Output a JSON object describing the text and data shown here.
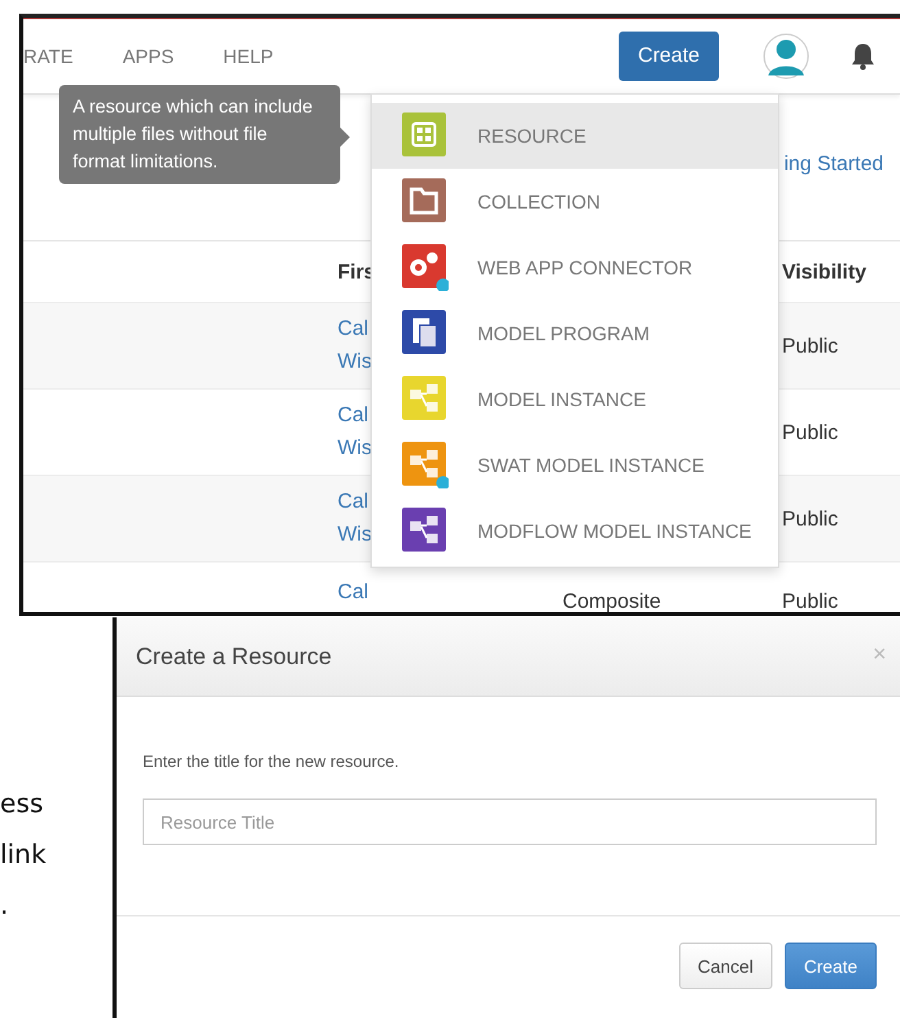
{
  "side_text": [
    "ess",
    "link",
    "."
  ],
  "nav": {
    "items": [
      "RATE",
      "APPS",
      "HELP"
    ],
    "create_button": "Create"
  },
  "getting_started_link": "ing Started",
  "table": {
    "columns": [
      "",
      "Firs",
      "",
      "Visibility"
    ],
    "rows": [
      {
        "column_2": [
          "Cal",
          "Wis"
        ],
        "column_3": "",
        "visibility": "Public"
      },
      {
        "column_2": [
          "Cal",
          "Wis"
        ],
        "column_3": "",
        "visibility": "Public"
      },
      {
        "column_2": [
          "Cal",
          "Wis"
        ],
        "column_3": "",
        "visibility": "Public"
      },
      {
        "column_2": [
          "Cal"
        ],
        "column_3": "Composite",
        "visibility": "Public"
      }
    ]
  },
  "tooltip": "A resource which can include multiple files without file format limitations.",
  "menu": [
    {
      "label": "RESOURCE",
      "kind": "resource",
      "color": "#a9c23a",
      "selected": true
    },
    {
      "label": "COLLECTION",
      "kind": "collection",
      "color": "#a56b5a",
      "selected": false
    },
    {
      "label": "WEB APP CONNECTOR",
      "kind": "webapp",
      "color": "#d9392f",
      "selected": false
    },
    {
      "label": "MODEL PROGRAM",
      "kind": "program",
      "color": "#2d4aa8",
      "selected": false
    },
    {
      "label": "MODEL INSTANCE",
      "kind": "instance",
      "color": "#e8d62e",
      "selected": false
    },
    {
      "label": "SWAT MODEL INSTANCE",
      "kind": "swat",
      "color": "#ee9410",
      "selected": false
    },
    {
      "label": "MODFLOW MODEL INSTANCE",
      "kind": "modflow",
      "color": "#6a3fb0",
      "selected": false
    }
  ],
  "dialog": {
    "title": "Create a Resource",
    "close": "×",
    "prompt": "Enter the title for the new resource.",
    "placeholder": "Resource Title",
    "buttons": [
      {
        "label": "Cancel",
        "kind": "default"
      },
      {
        "label": "Create",
        "kind": "primary"
      }
    ]
  }
}
